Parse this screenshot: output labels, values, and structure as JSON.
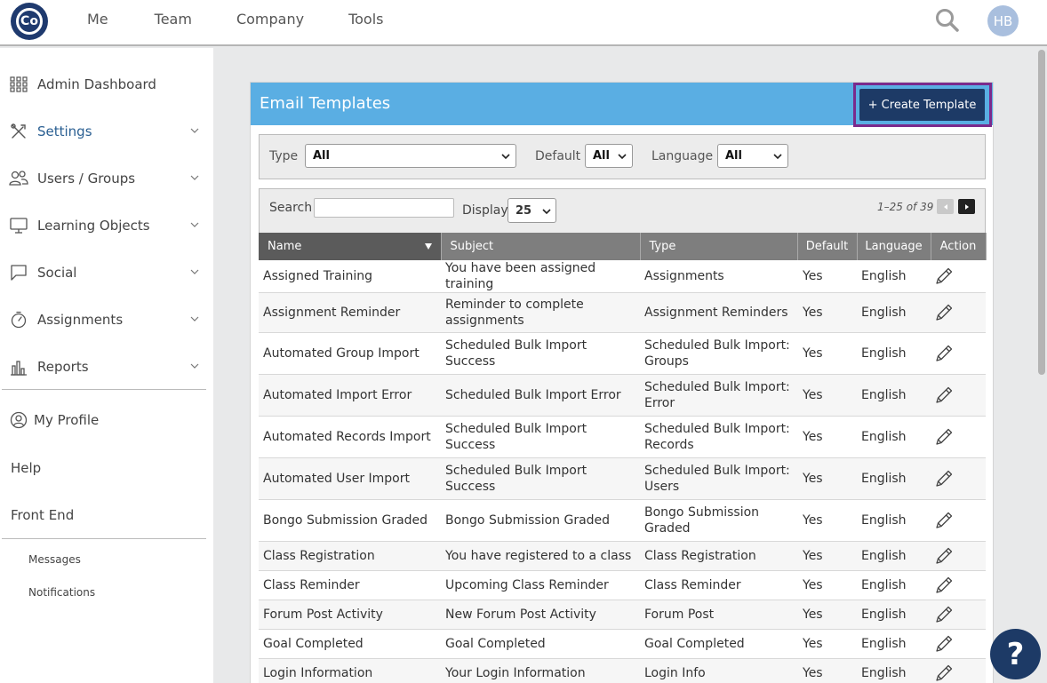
{
  "logo": {
    "text": "Co"
  },
  "topnav": {
    "me": "Me",
    "team": "Team",
    "company": "Company",
    "tools": "Tools"
  },
  "user": {
    "initials": "HB"
  },
  "sidebar": {
    "items": [
      {
        "label": "Admin Dashboard",
        "icon": "grid-icon"
      },
      {
        "label": "Settings",
        "icon": "tools-icon"
      },
      {
        "label": "Users / Groups",
        "icon": "users-icon"
      },
      {
        "label": "Learning Objects",
        "icon": "monitor-icon"
      },
      {
        "label": "Social",
        "icon": "chat-icon"
      },
      {
        "label": "Assignments",
        "icon": "stopwatch-icon"
      },
      {
        "label": "Reports",
        "icon": "bar-chart-icon"
      }
    ],
    "profile": "My Profile",
    "help": "Help",
    "front_end": "Front End",
    "messages": "Messages",
    "notifications": "Notifications"
  },
  "panel": {
    "title": "Email Templates",
    "create_label": "+ Create Template"
  },
  "filters": {
    "type_label": "Type",
    "type_value": "All",
    "default_label": "Default",
    "default_value": "All",
    "language_label": "Language",
    "language_value": "All"
  },
  "toolbar": {
    "search_label": "Search",
    "search_value": "",
    "display_label": "Display",
    "display_value": "25",
    "pager_text": "1–25 of 39"
  },
  "table": {
    "headers": {
      "name": "Name",
      "subject": "Subject",
      "type": "Type",
      "default": "Default",
      "language": "Language",
      "action": "Action"
    },
    "rows": [
      {
        "name": "Assigned Training",
        "subject": "You have been assigned training",
        "type": "Assignments",
        "default": "Yes",
        "language": "English"
      },
      {
        "name": "Assignment Reminder",
        "subject": "Reminder to complete assignments",
        "type": "Assignment Reminders",
        "default": "Yes",
        "language": "English"
      },
      {
        "name": "Automated Group Import",
        "subject": "Scheduled Bulk Import Success",
        "type": "Scheduled Bulk Import: Groups",
        "default": "Yes",
        "language": "English"
      },
      {
        "name": "Automated Import Error",
        "subject": "Scheduled Bulk Import Error",
        "type": "Scheduled Bulk Import: Error",
        "default": "Yes",
        "language": "English"
      },
      {
        "name": "Automated Records Import",
        "subject": "Scheduled Bulk Import Success",
        "type": "Scheduled Bulk Import: Records",
        "default": "Yes",
        "language": "English"
      },
      {
        "name": "Automated User Import",
        "subject": "Scheduled Bulk Import Success",
        "type": "Scheduled Bulk Import: Users",
        "default": "Yes",
        "language": "English"
      },
      {
        "name": "Bongo Submission Graded",
        "subject": "Bongo Submission Graded",
        "type": "Bongo Submission Graded",
        "default": "Yes",
        "language": "English"
      },
      {
        "name": "Class Registration",
        "subject": "You have registered to a class",
        "type": "Class Registration",
        "default": "Yes",
        "language": "English"
      },
      {
        "name": "Class Reminder",
        "subject": "Upcoming Class Reminder",
        "type": "Class Reminder",
        "default": "Yes",
        "language": "English"
      },
      {
        "name": "Forum Post Activity",
        "subject": "New Forum Post Activity",
        "type": "Forum Post",
        "default": "Yes",
        "language": "English"
      },
      {
        "name": "Goal Completed",
        "subject": "Goal Completed",
        "type": "Goal Completed",
        "default": "Yes",
        "language": "English"
      },
      {
        "name": "Login Information",
        "subject": "Your Login Information",
        "type": "Login Info",
        "default": "Yes",
        "language": "English"
      }
    ]
  },
  "help_button": "?",
  "colors": {
    "header_blue": "#5aaee3",
    "navy": "#1d3a66",
    "highlight": "#7a2a8c"
  }
}
